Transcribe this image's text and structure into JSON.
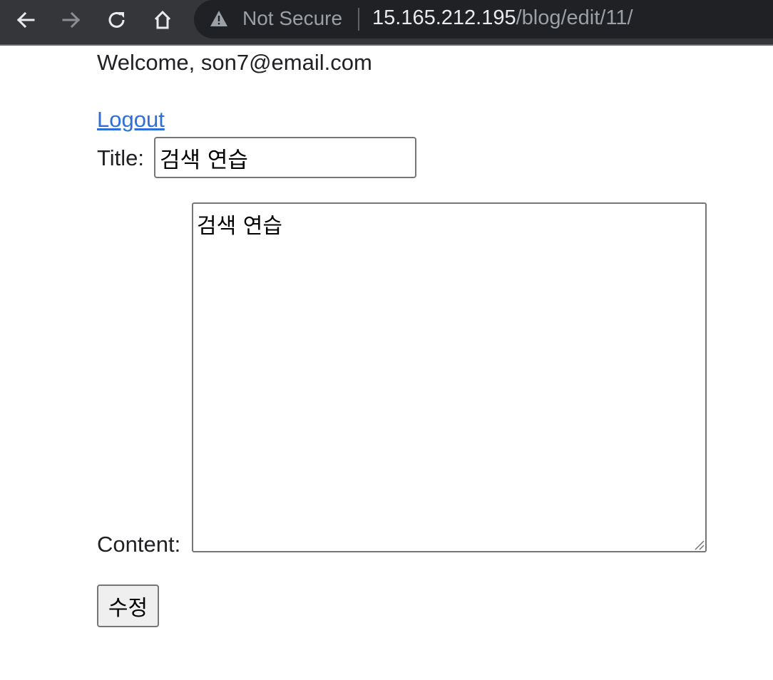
{
  "browser": {
    "security_label": "Not Secure",
    "url_host": "15.165.212.195",
    "url_path": "/blog/edit/11/",
    "icons": {
      "back": "arrow-left-icon",
      "forward": "arrow-right-icon",
      "reload": "reload-icon",
      "home": "home-icon",
      "warning": "warning-triangle-icon"
    },
    "colors": {
      "toolbar": "#35363a",
      "omnibox": "#202124",
      "host_text": "#e8eaed",
      "dim_text": "#9aa0a6"
    }
  },
  "page": {
    "welcome_text": "Welcome, son7@email.com",
    "logout_label": "Logout",
    "link_color": "#2e6fd8",
    "form": {
      "title_label": "Title:",
      "title_value": "검색 연습",
      "content_label": "Content:",
      "content_value": "검색 연습",
      "submit_label": "수정"
    }
  }
}
